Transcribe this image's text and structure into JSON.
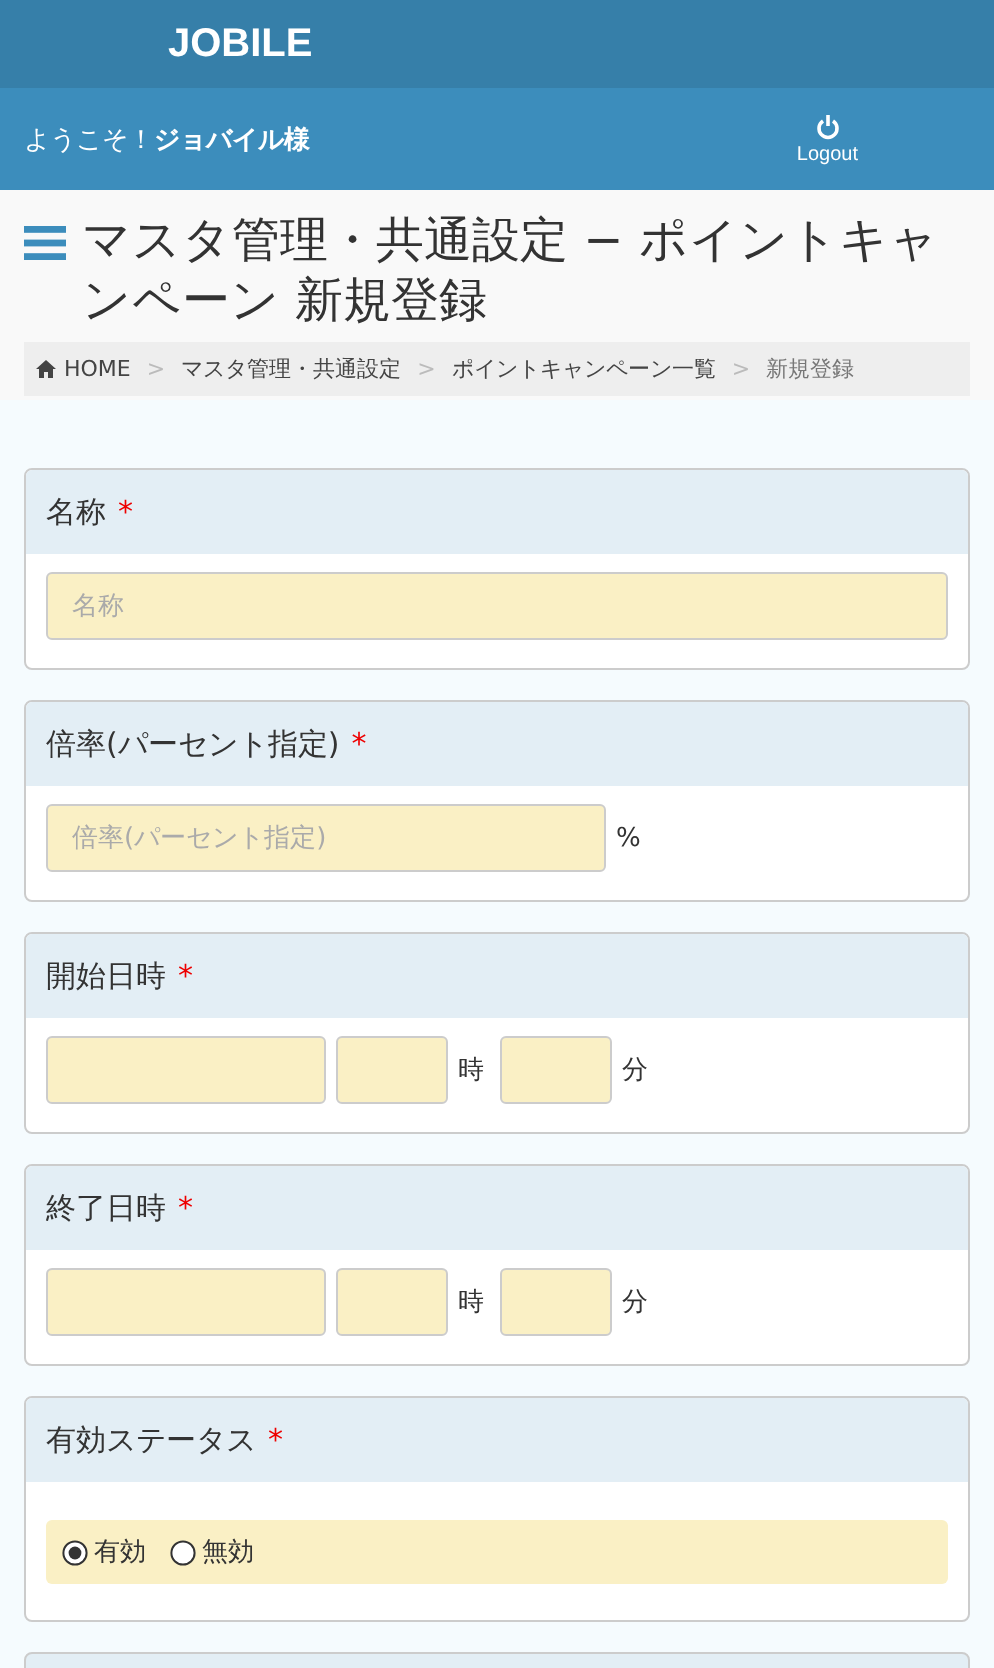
{
  "header": {
    "logo": "JOBILE"
  },
  "user_bar": {
    "greeting": "ようこそ！",
    "user_name": "ジョバイル様",
    "logout": "Logout"
  },
  "page_title": "マスタ管理・共通設定 − ポイントキャンペーン 新規登録",
  "breadcrumb": [
    {
      "label": "HOME",
      "kind": "home"
    },
    {
      "label": "マスタ管理・共通設定",
      "kind": "link"
    },
    {
      "label": "ポイントキャンペーン一覧",
      "kind": "link"
    },
    {
      "label": "新規登録",
      "kind": "current"
    }
  ],
  "breadcrumb_separator": ">",
  "panels": [
    {
      "label": "名称",
      "required_mark": "*",
      "kind": "text",
      "placeholder": "名称"
    },
    {
      "label": "倍率(パーセント指定)",
      "required_mark": "*",
      "kind": "percent",
      "placeholder": "倍率(パーセント指定)",
      "suffix": "%"
    },
    {
      "label": "開始日時",
      "required_mark": "*",
      "kind": "datetime",
      "hour_unit": "時",
      "minute_unit": "分"
    },
    {
      "label": "終了日時",
      "required_mark": "*",
      "kind": "datetime",
      "hour_unit": "時",
      "minute_unit": "分"
    },
    {
      "label": "有効ステータス",
      "required_mark": "*",
      "kind": "radio",
      "options": [
        {
          "label": "有効",
          "selected": true
        },
        {
          "label": "無効",
          "selected": false
        }
      ]
    }
  ]
}
